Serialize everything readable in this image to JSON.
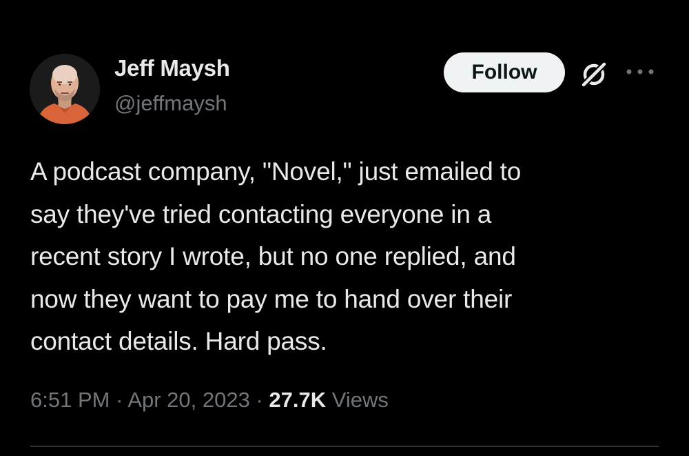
{
  "author": {
    "name": "Jeff Maysh",
    "handle": "@jeffmaysh",
    "avatar": "profile-photo"
  },
  "actions": {
    "follow_label": "Follow",
    "grok_icon": "grok-icon",
    "more_icon": "more-icon"
  },
  "tweet": {
    "lines": [
      "A podcast company, \"Novel,\" just emailed to",
      "say they've tried contacting everyone in a",
      "recent story I wrote, but no one replied, and",
      "now they want to pay me to hand over their",
      "contact details. Hard pass."
    ]
  },
  "meta": {
    "time": "6:51 PM",
    "separator": "·",
    "date": "Apr 20, 2023",
    "views_count": "27.7K",
    "views_label": "Views"
  },
  "colors": {
    "background": "#000000",
    "text_primary": "#e7e9ea",
    "text_secondary": "#71767b",
    "follow_bg": "#eff3f4",
    "divider": "#2f3336"
  }
}
